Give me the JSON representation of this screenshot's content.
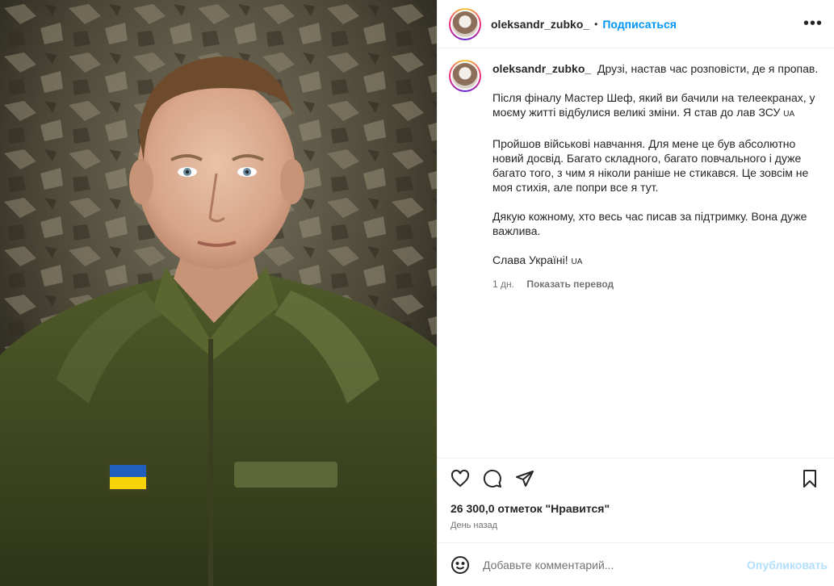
{
  "post": {
    "username": "oleksandr_zubko_",
    "follow_label": "Подписаться",
    "header_separator": "•",
    "more_label": "•••"
  },
  "caption": {
    "username": "oleksandr_zubko_",
    "first_line": "Друзі, настав час розповісти, де я пропав.",
    "paragraph2": "Після фіналу Мастер Шеф, який ви бачили на телеекранах, у моєму житті відбулися великі зміни. Я став до лав ЗСУ",
    "paragraph2_flag": "UA",
    "paragraph3": "Пройшов військові навчання. Для мене це був абсолютно новий досвід. Багато складного, багато повчального і дуже багато того, з чим я ніколи раніше не стикався. Це зовсім не моя стихія, але попри все я тут.",
    "paragraph4": "Дякую кожному, хто весь час писав за підтримку. Вона дуже важлива.",
    "paragraph5": "Слава Україні!",
    "paragraph5_flag": "UA",
    "time": "1 дн.",
    "translate": "Показать перевод"
  },
  "stats": {
    "likes": "26 300,0 отметок \"Нравится\"",
    "date": "День назад"
  },
  "comment": {
    "placeholder": "Добавьте комментарий...",
    "publish_label": "Опубликовать"
  },
  "colors": {
    "accent": "#0095f6",
    "publish_disabled": "#b2dffc",
    "muted": "#737373",
    "text": "#262626",
    "flag_blue": "#1f5fbf",
    "flag_yellow": "#f5d20a"
  },
  "icons": {
    "like": "heart-icon",
    "comment": "comment-icon",
    "share": "paper-plane-icon",
    "save": "bookmark-icon",
    "emoji": "smiley-icon",
    "more": "more-options-icon"
  }
}
